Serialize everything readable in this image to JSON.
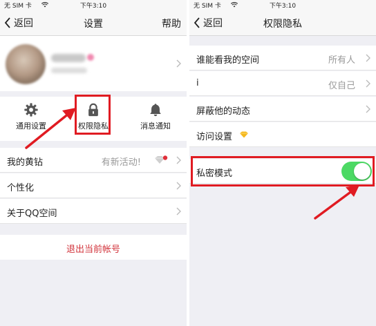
{
  "statusbar": {
    "carrier": "无 SIM 卡",
    "time": "下午3:10"
  },
  "left": {
    "nav": {
      "back": "返回",
      "title": "设置",
      "help": "帮助"
    },
    "icons": [
      {
        "label": "通用设置",
        "icon": "gear-icon"
      },
      {
        "label": "权限隐私",
        "icon": "lock-icon"
      },
      {
        "label": "消息通知",
        "icon": "bell-icon"
      }
    ],
    "rows": [
      {
        "label": "我的黄钻",
        "value": "有新活动!"
      },
      {
        "label": "个性化",
        "value": ""
      },
      {
        "label": "关于QQ空间",
        "value": ""
      }
    ],
    "logout": "退出当前帐号"
  },
  "right": {
    "nav": {
      "back": "返回",
      "title": "权限隐私"
    },
    "rows": [
      {
        "label": "谁能看我的空间",
        "value": "所有人"
      },
      {
        "label": "i",
        "value": "仅自己"
      },
      {
        "label": "屏蔽他的动态",
        "value": ""
      },
      {
        "label": "访问设置",
        "value": ""
      }
    ],
    "private_mode": {
      "label": "私密模式",
      "enabled": true
    }
  },
  "colors": {
    "highlight": "#e01b22",
    "toggle_on": "#4cd964",
    "logout": "#d2343c"
  }
}
